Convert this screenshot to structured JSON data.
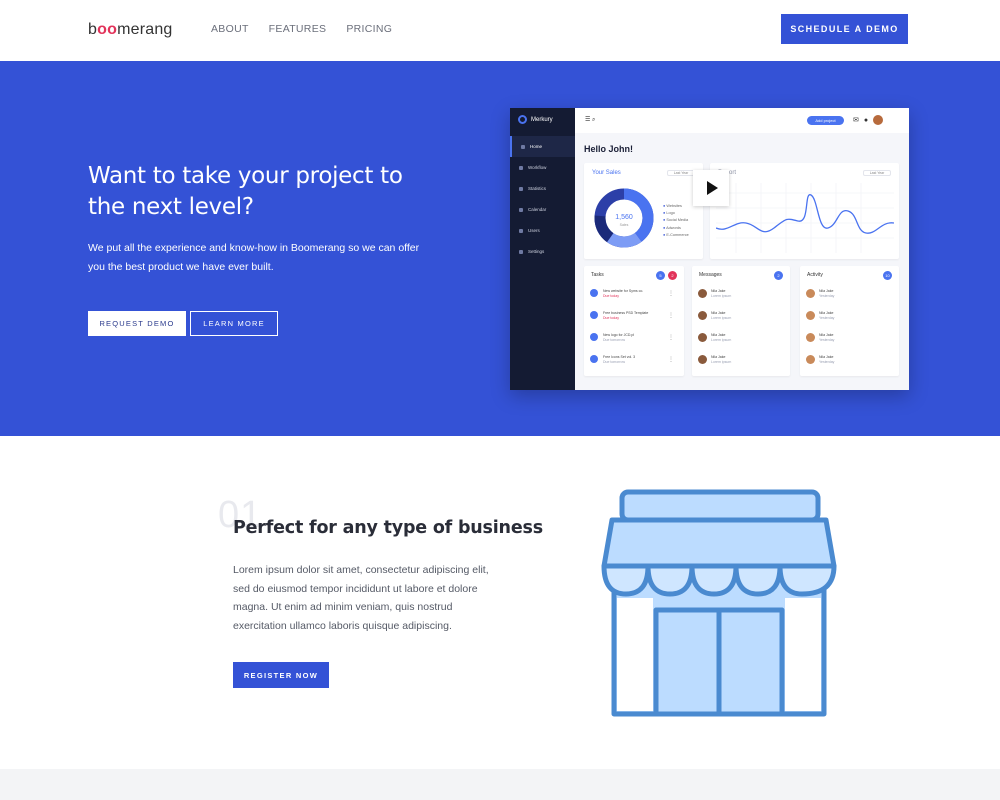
{
  "header": {
    "logo_prefix": "b",
    "logo_oo": "oo",
    "logo_suffix": "merang",
    "nav": [
      "ABOUT",
      "FEATURES",
      "PRICING"
    ],
    "cta": "SCHEDULE A DEMO"
  },
  "hero": {
    "title": "Want to take your project to the next level?",
    "subtitle": "We put all the experience and know-how in Boomerang so we can offer you the best product we have ever built.",
    "primary_button": "REQUEST DEMO",
    "secondary_button": "LEARN MORE"
  },
  "dashboard": {
    "brand": "Merkury",
    "menu": [
      "Home",
      "Workflow",
      "Statistics",
      "Calendar",
      "Users",
      "Settings"
    ],
    "add_button": "Add project",
    "greeting": "Hello John!",
    "sales_card": {
      "title": "Your Sales",
      "dropdown": "Last Year",
      "center_value": "1,560",
      "center_label": "Sales",
      "legend": [
        "Websites",
        "Logo",
        "Social Media",
        "Adwords",
        "E-Commerce"
      ]
    },
    "report_card": {
      "title": "Report",
      "dropdown": "Last Year"
    },
    "tasks": {
      "title": "Tasks",
      "badges": [
        "5",
        "2"
      ],
      "rows": [
        {
          "text": "New website for Syms co.",
          "meta": "Due today"
        },
        {
          "text": "Free business PSD Template",
          "meta": "Due today"
        },
        {
          "text": "New logo for JCD.pl",
          "meta": "Due tomorrow"
        },
        {
          "text": "Free Icons Set vol. 3",
          "meta": "Due tomorrow"
        }
      ]
    },
    "messages": {
      "title": "Messages",
      "badge": "2",
      "rows": [
        {
          "text": "Nila Jake",
          "meta": "Lorem ipsum"
        },
        {
          "text": "Nila Jake",
          "meta": "Lorem ipsum"
        },
        {
          "text": "Nila Jake",
          "meta": "Lorem ipsum"
        },
        {
          "text": "Nila Jake",
          "meta": "Lorem ipsum"
        }
      ]
    },
    "activity": {
      "title": "Activity",
      "badge": "10",
      "rows": [
        {
          "text": "Nila Jake",
          "meta": "Yesterday"
        },
        {
          "text": "Nila Jake",
          "meta": "Yesterday"
        },
        {
          "text": "Nila Jake",
          "meta": "Yesterday"
        },
        {
          "text": "Nila Jake",
          "meta": "Yesterday"
        }
      ]
    }
  },
  "feature": {
    "number": "01",
    "title": "Perfect for any type of business",
    "text": "Lorem ipsum dolor sit amet, consectetur adipiscing elit, sed do eiusmod tempor incididunt ut labore et dolore magna. Ut enim ad minim veniam, quis nostrud exercitation ullamco laboris quisque adipiscing.",
    "button": "REGISTER NOW"
  },
  "colors": {
    "brand_blue": "#3452d6",
    "accent_pink": "#e2335a",
    "store_fill": "#bcdcff",
    "store_stroke": "#4a8ad0"
  },
  "icons": {
    "store": "store-icon",
    "play": "play-icon"
  }
}
